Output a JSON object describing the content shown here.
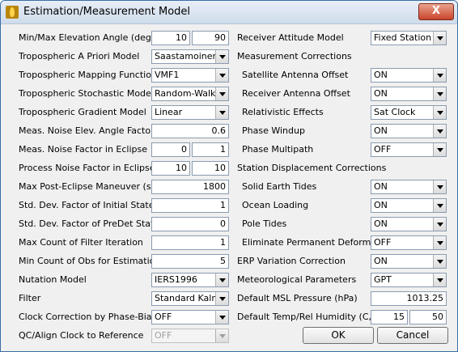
{
  "window": {
    "title": "Estimation/Measurement Model",
    "close_glyph": "X"
  },
  "left": {
    "min_max_elev": {
      "label": "Min/Max Elevation Angle (deg)",
      "min": "10",
      "max": "90"
    },
    "tropo_apriori": {
      "label": "Tropospheric A Priori Model",
      "value": "Saastamoinen"
    },
    "tropo_mapping": {
      "label": "Tropospheric Mapping Function",
      "value": "VMF1"
    },
    "tropo_stochastic": {
      "label": "Tropospheric Stochastic Model",
      "value": "Random-Walk"
    },
    "tropo_gradient": {
      "label": "Tropospheric Gradient Model",
      "value": "Linear"
    },
    "noise_elev_factor": {
      "label": "Meas. Noise Elev. Angle Factor",
      "value": "0.6"
    },
    "noise_eclipse": {
      "label": "Meas. Noise Factor in Eclipse",
      "v1": "0",
      "v2": "1"
    },
    "process_noise_eclipse": {
      "label": "Process Noise Factor in Eclipse",
      "v1": "10",
      "v2": "10"
    },
    "post_eclipse": {
      "label": "Max Post-Eclipse Maneuver (sec)",
      "value": "1800"
    },
    "std_initial": {
      "label": "Std. Dev. Factor of Initial States",
      "value": "1"
    },
    "std_predet": {
      "label": "Std. Dev. Factor of PreDet States",
      "value": "0"
    },
    "max_filter_iter": {
      "label": "Max Count of Filter Iteration",
      "value": "1"
    },
    "min_obs": {
      "label": "Min Count of Obs for Estimation",
      "value": "5"
    },
    "nutation": {
      "label": "Nutation Model",
      "value": "IERS1996"
    },
    "filter": {
      "label": "Filter",
      "value": "Standard Kalman"
    },
    "clock_correction": {
      "label": "Clock Correction by Phase-Bias",
      "value": "OFF"
    },
    "qc_align": {
      "label": "QC/Align Clock to Reference",
      "value": "OFF"
    }
  },
  "right": {
    "receiver_attitude": {
      "label": "Receiver Attitude Model",
      "value": "Fixed Station"
    },
    "meas_corrections_header": "Measurement Corrections",
    "sat_antenna": {
      "label": "Satellite Antenna Offset",
      "value": "ON"
    },
    "rcv_antenna": {
      "label": "Receiver Antenna Offset",
      "value": "ON"
    },
    "relativistic": {
      "label": "Relativistic Effects",
      "value": "Sat Clock"
    },
    "phase_windup": {
      "label": "Phase Windup",
      "value": "ON"
    },
    "phase_multipath": {
      "label": "Phase Multipath",
      "value": "OFF"
    },
    "station_disp_header": "Station Displacement Corrections",
    "solid_earth": {
      "label": "Solid Earth Tides",
      "value": "ON"
    },
    "ocean_loading": {
      "label": "Ocean Loading",
      "value": "ON"
    },
    "pole_tides": {
      "label": "Pole Tides",
      "value": "ON"
    },
    "perm_deform": {
      "label": "Eliminate Permanent Deform.",
      "value": "OFF"
    },
    "erp_variation": {
      "label": "ERP Variation Correction",
      "value": "ON"
    },
    "met_params": {
      "label": "Meteorological Parameters",
      "value": "GPT"
    },
    "msl_pressure": {
      "label": "Default MSL Pressure (hPa)",
      "value": "1013.25"
    },
    "temp_humidity": {
      "label": "Default Temp/Rel Humidity (C,%)",
      "temp": "15",
      "humidity": "50"
    }
  },
  "buttons": {
    "ok": "OK",
    "cancel": "Cancel"
  }
}
